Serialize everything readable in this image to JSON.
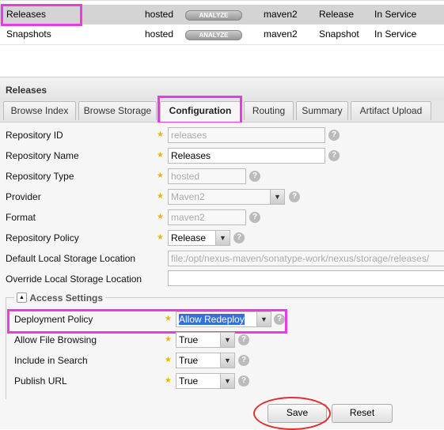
{
  "repo_list": [
    {
      "name": "Releases",
      "type": "hosted",
      "action": "ANALYZE",
      "format": "maven2",
      "policy": "Release",
      "status": "In Service"
    },
    {
      "name": "Snapshots",
      "type": "hosted",
      "action": "ANALYZE",
      "format": "maven2",
      "policy": "Snapshot",
      "status": "In Service"
    }
  ],
  "panel": {
    "title": "Releases"
  },
  "tabs": [
    "Browse Index",
    "Browse Storage",
    "Configuration",
    "Routing",
    "Summary",
    "Artifact Upload"
  ],
  "active_tab": "Configuration",
  "form": {
    "repository_id": {
      "label": "Repository ID",
      "value": "releases"
    },
    "repository_name": {
      "label": "Repository Name",
      "value": "Releases"
    },
    "repository_type": {
      "label": "Repository Type",
      "value": "hosted"
    },
    "provider": {
      "label": "Provider",
      "value": "Maven2"
    },
    "format": {
      "label": "Format",
      "value": "maven2"
    },
    "repository_policy": {
      "label": "Repository Policy",
      "value": "Release"
    },
    "default_storage": {
      "label": "Default Local Storage Location",
      "value": "file:/opt/nexus-maven/sonatype-work/nexus/storage/releases/"
    },
    "override_storage": {
      "label": "Override Local Storage Location",
      "value": ""
    }
  },
  "access": {
    "title": "Access Settings",
    "deployment_policy": {
      "label": "Deployment Policy",
      "value": "Allow Redeploy"
    },
    "file_browsing": {
      "label": "Allow File Browsing",
      "value": "True"
    },
    "include_search": {
      "label": "Include in Search",
      "value": "True"
    },
    "publish_url": {
      "label": "Publish URL",
      "value": "True"
    }
  },
  "buttons": {
    "save": "Save",
    "reset": "Reset"
  },
  "colors": {
    "highlight": "#e83be8",
    "circle": "#e03030"
  }
}
